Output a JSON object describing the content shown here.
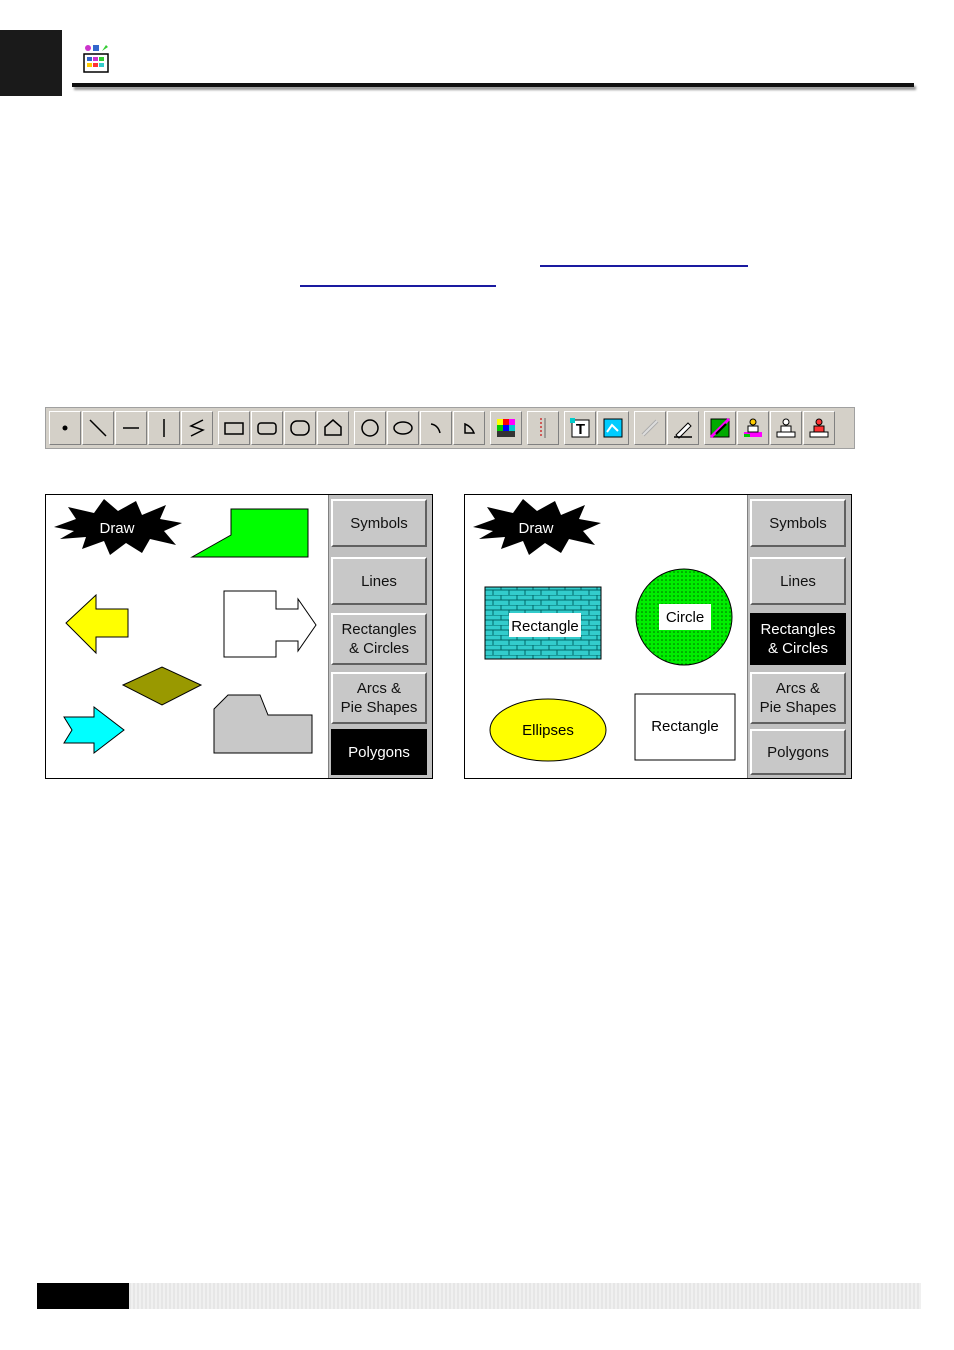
{
  "header": {
    "icon": "drawing-toolbox-icon"
  },
  "toolbar": {
    "groups": [
      [
        "point-icon",
        "line-icon",
        "horizontal-line-icon",
        "vertical-line-icon",
        "polyline-icon"
      ],
      [
        "rectangle-icon",
        "rounded-rectangle-icon",
        "rounded-rectangle-large-icon",
        "polygon-icon"
      ],
      [
        "circle-icon",
        "ellipse-icon",
        "arc-icon",
        "pie-icon"
      ],
      [
        "color-grid-icon"
      ],
      [
        "scale-icon"
      ],
      [
        "text-icon",
        "picture-icon"
      ],
      [
        "link-icon",
        "pen-edit-icon"
      ],
      [
        "palette-icon",
        "stamp-color-icon",
        "stamp-icon",
        "stamp-red-icon"
      ]
    ]
  },
  "panel_left": {
    "burst_label": "Draw",
    "colors": {
      "green": "#00ff00",
      "yellow": "#ffff00",
      "cyan": "#00ffff",
      "olive": "#999900",
      "gray": "#c8c8c8"
    },
    "buttons": [
      "Symbols",
      "Lines",
      "Rectangles\n& Circles",
      "Arcs &\nPie Shapes",
      "Polygons"
    ],
    "active_button": "Polygons"
  },
  "panel_right": {
    "burst_label": "Draw",
    "shapes": {
      "brick_rect_label": "Rectangle",
      "circle_label": "Circle",
      "ellipse_label": "Ellipses",
      "plain_rect_label": "Rectangle"
    },
    "colors": {
      "cyan": "#33cccc",
      "green": "#00ee00",
      "yellow": "#ffff00"
    },
    "buttons": [
      "Symbols",
      "Lines",
      "Rectangles\n& Circles",
      "Arcs &\nPie Shapes",
      "Polygons"
    ],
    "active_button": "Rectangles\n& Circles"
  }
}
